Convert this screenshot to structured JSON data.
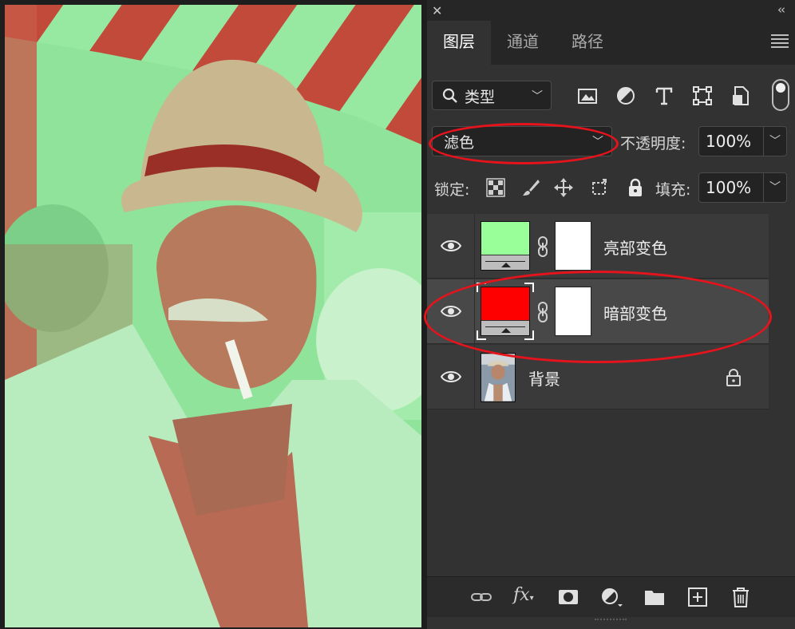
{
  "tabs": [
    {
      "label": "图层",
      "active": true
    },
    {
      "label": "通道",
      "active": false
    },
    {
      "label": "路径",
      "active": false
    }
  ],
  "filter": {
    "kind_label": "类型"
  },
  "blend": {
    "mode": "滤色"
  },
  "opacity": {
    "label": "不透明度:",
    "value": "100%"
  },
  "lock": {
    "label": "锁定:"
  },
  "fill": {
    "label": "填充:",
    "value": "100%"
  },
  "layers": [
    {
      "name": "亮部变色",
      "thumb_color": "#99ff99",
      "selected": false
    },
    {
      "name": "暗部变色",
      "thumb_color": "#ff0000",
      "selected": true
    },
    {
      "name": "背景",
      "locked": true
    }
  ],
  "bottom_icons": [
    "link-icon",
    "fx-icon",
    "add-mask-icon",
    "adjustment-layer-icon",
    "group-folder-icon",
    "new-layer-icon",
    "delete-icon"
  ],
  "annotation_color": "#e5131b",
  "fx_label": "fx"
}
